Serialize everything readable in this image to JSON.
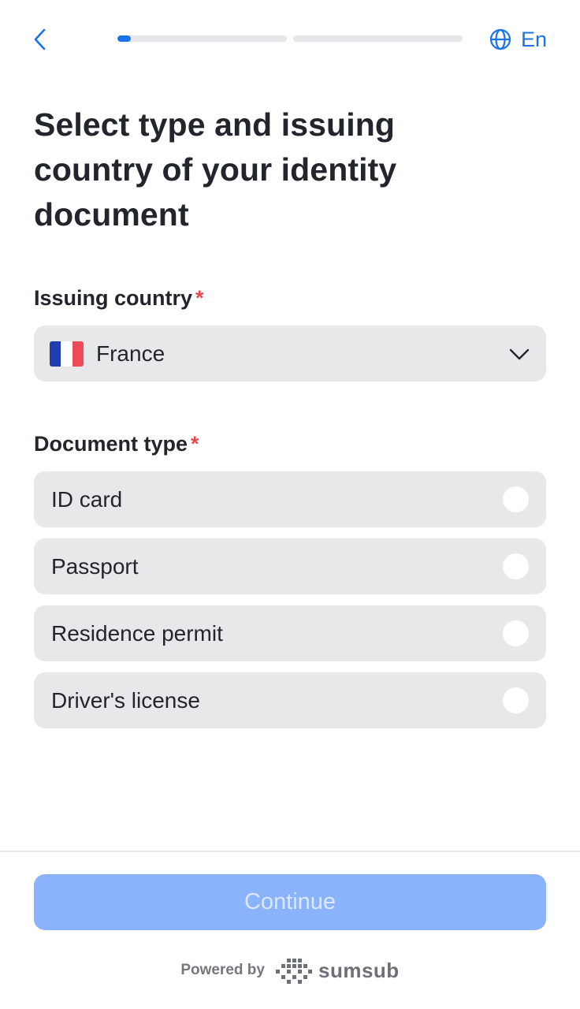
{
  "header": {
    "language_label": "En",
    "progress": {
      "segments": 2,
      "current": 1,
      "first_segment_fraction": 0.08
    }
  },
  "title": "Select type and issuing country of your identity document",
  "country": {
    "label": "Issuing country",
    "required_mark": "*",
    "selected": "France",
    "flag_colors": [
      "#1f3fb0",
      "#ffffff",
      "#ee4b5a"
    ]
  },
  "document": {
    "label": "Document type",
    "required_mark": "*",
    "options": [
      {
        "label": "ID card",
        "selected": false
      },
      {
        "label": "Passport",
        "selected": false
      },
      {
        "label": "Residence permit",
        "selected": false
      },
      {
        "label": "Driver's license",
        "selected": false
      }
    ]
  },
  "footer": {
    "continue_label": "Continue",
    "continue_disabled": true,
    "powered_by": "Powered by",
    "brand": "sumsub"
  },
  "colors": {
    "accent": "#1a73e8",
    "button_disabled": "#8bb3fb",
    "required": "#e5484d",
    "field_bg": "#e8e8eb"
  },
  "icons": [
    "chevron-left-icon",
    "globe-icon",
    "chevron-down-icon",
    "sumsub-logo-icon"
  ]
}
